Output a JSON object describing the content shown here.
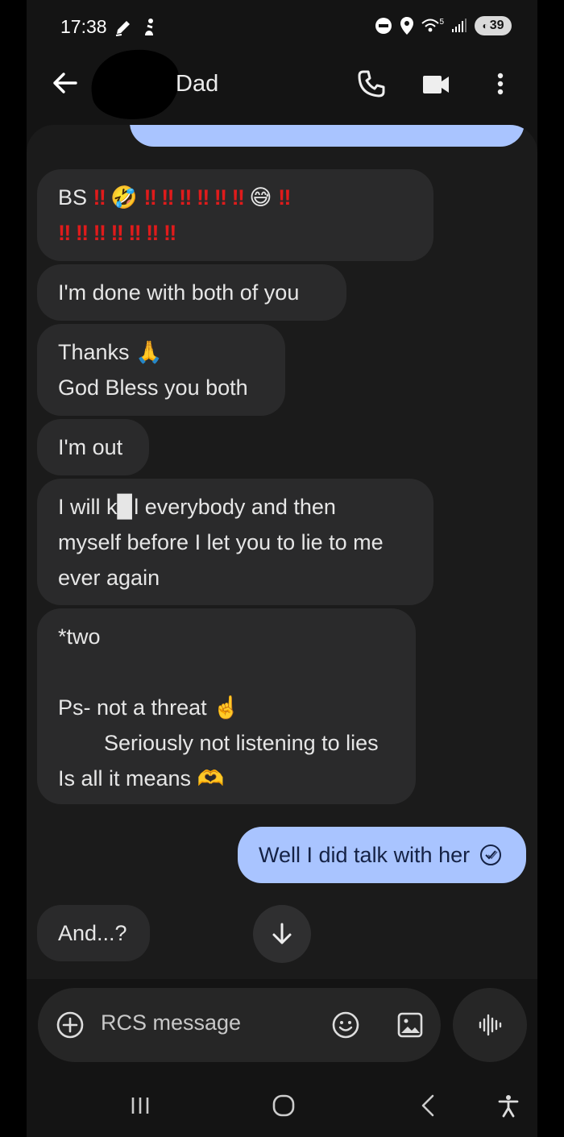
{
  "status_bar": {
    "time": "17:38",
    "battery": "39",
    "network": "5"
  },
  "header": {
    "contact_name": "Dad"
  },
  "messages": [
    {
      "direction": "incoming",
      "lines": [
        "BS ‼️ 🤣 ‼️ ‼️ ‼️ ‼️ ‼️ ‼️ 😅 ‼️",
        "‼️ ‼️ ‼️ ‼️ ‼️ ‼️ ‼️"
      ]
    },
    {
      "direction": "incoming",
      "lines": [
        "I'm done with both of you"
      ]
    },
    {
      "direction": "incoming",
      "lines": [
        "Thanks 🙏",
        "God Bless you both"
      ]
    },
    {
      "direction": "incoming",
      "lines": [
        "I'm out"
      ]
    },
    {
      "direction": "incoming",
      "lines": [
        "I will k▉l everybody and then",
        "myself before I let you to lie to me",
        "ever again"
      ]
    },
    {
      "direction": "incoming",
      "lines": [
        "*two",
        "",
        "Ps- not a threat ☝️",
        "Seriously not listening to lies",
        "Is all it means 🫶"
      ]
    },
    {
      "direction": "outgoing",
      "lines": [
        "Well I did talk with her"
      ],
      "status": "read"
    },
    {
      "direction": "incoming",
      "lines": [
        "And...?"
      ]
    }
  ],
  "composer": {
    "placeholder": "RCS message"
  },
  "icons": {
    "back": "back-arrow-icon",
    "call": "phone-icon",
    "video": "video-camera-icon",
    "menu": "more-vert-icon",
    "scroll_down": "arrow-down-icon",
    "add": "add-circle-icon",
    "emoji": "emoji-icon",
    "gallery": "image-icon",
    "voice": "voice-waveform-icon"
  },
  "colors": {
    "incoming_bubble": "#2a2a2b",
    "outgoing_bubble": "#a9c4ff",
    "background": "#1b1b1b"
  }
}
